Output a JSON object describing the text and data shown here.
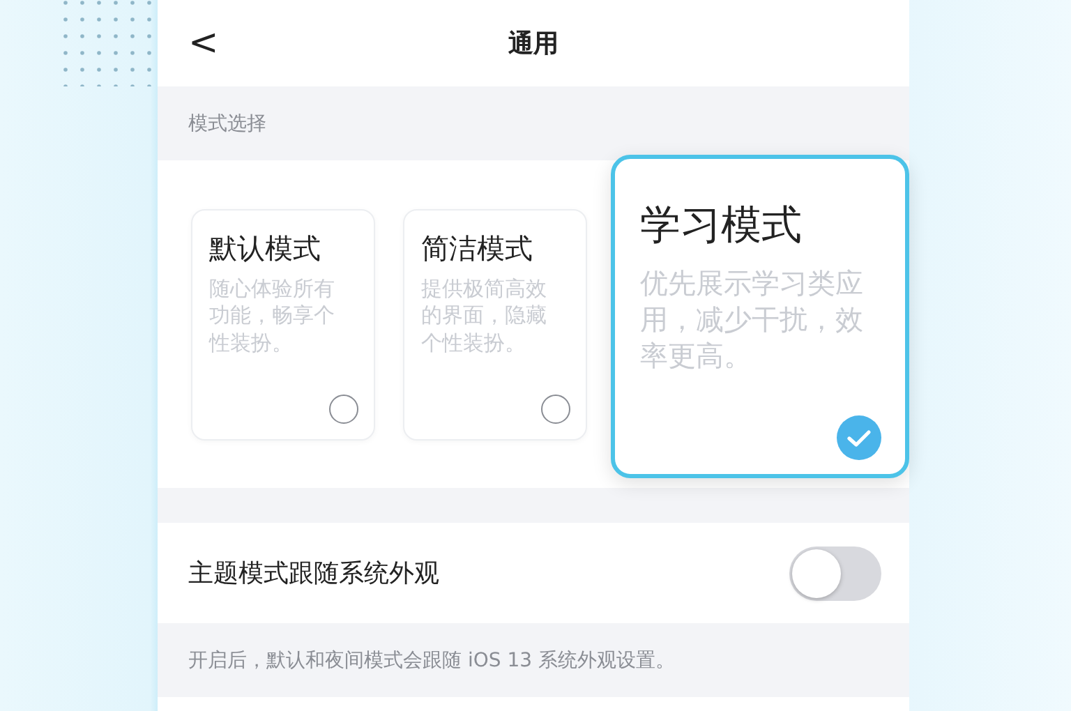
{
  "nav": {
    "back": "<",
    "title": "通用"
  },
  "section_header": "模式选择",
  "modes": [
    {
      "title": "默认模式",
      "description": "随心体验所有功能，畅享个性装扮。",
      "selected": false
    },
    {
      "title": "简洁模式",
      "description": "提供极简高效的界面，隐藏个性装扮。",
      "selected": false
    },
    {
      "title": "学习模式",
      "description": "优先展示学习类应用，减少干扰，效率更高。",
      "selected": true
    }
  ],
  "setting": {
    "label": "主题模式跟随系统外观",
    "on": false
  },
  "footnote": "开启后，默认和夜间模式会跟随 iOS 13 系统外观设置。"
}
